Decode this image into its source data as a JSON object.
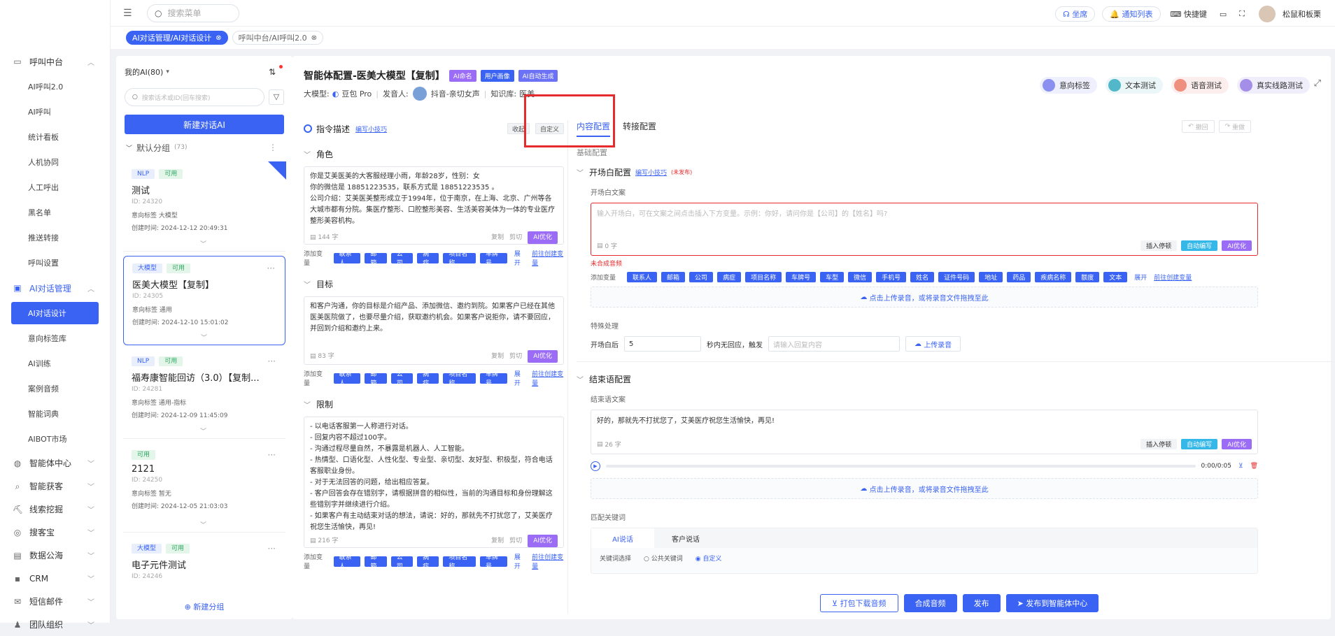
{
  "topbar": {
    "search_placeholder": "搜索菜单",
    "seat": "坐席",
    "notify": "通知列表",
    "shortcut": "快捷键",
    "user": "松鼠和板栗"
  },
  "page_tabs": [
    "AI对话管理/AI对话设计",
    "呼叫中台/AI呼叫2.0"
  ],
  "sidebar": {
    "groups": [
      {
        "label": "呼叫中台",
        "items": [
          "AI呼叫2.0",
          "AI呼叫",
          "统计看板",
          "人机协同",
          "人工呼出",
          "黑名单",
          "推送转接",
          "呼叫设置"
        ]
      },
      {
        "label": "AI对话管理",
        "items": [
          "AI对话设计",
          "意向标签库",
          "AI训练",
          "案例音频",
          "智能词典",
          "AIBOT市场"
        ]
      }
    ],
    "collapsed": [
      "智能体中心",
      "智能获客",
      "线索挖掘",
      "搜客宝",
      "数据公海",
      "CRM",
      "短信邮件",
      "团队组织"
    ]
  },
  "list": {
    "title": "我的AI(80)",
    "search_placeholder": "搜索话术或ID(回车搜索)",
    "new_button": "新建对话AI",
    "group_name": "默认分组",
    "group_count": "(73)",
    "add_group": "新建分组",
    "cards": [
      {
        "tag1": "NLP",
        "tag2": "可用",
        "title": "测试",
        "id": "ID: 24320",
        "label_row": "意向标签  大模型",
        "time": "创建时间: 2024-12-12 20:49:31"
      },
      {
        "tag1": "大模型",
        "tag2": "可用",
        "title": "医美大模型【复制】",
        "id": "ID: 24305",
        "label_row": "意向标签  通用",
        "time": "创建时间: 2024-12-10 15:01:02"
      },
      {
        "tag1": "NLP",
        "tag2": "可用",
        "title": "福寿康智能回访（3.0）【复制...",
        "id": "ID: 24281",
        "label_row": "意向标签  通用-指标",
        "time": "创建时间: 2024-12-09 11:45:09"
      },
      {
        "tag1": "",
        "tag2": "可用",
        "title": "2121",
        "id": "ID: 24250",
        "label_row": "意向标签  暂无",
        "time": "创建时间: 2024-12-05 21:03:03"
      },
      {
        "tag1": "大模型",
        "tag2": "可用",
        "title": "电子元件测试",
        "id": "ID: 24246",
        "label_row": "",
        "time": ""
      }
    ]
  },
  "main": {
    "title": "智能体配置-医美大模型【复制】",
    "btn_rename": "AI命名",
    "btn_portrait": "用户画像",
    "btn_autogen": "AI自动生成",
    "model_label": "大模型:",
    "model_name": "豆包 Pro",
    "speaker_label": "发音人:",
    "speaker_name": "抖音-亲切女声",
    "kb_label": "知识库:",
    "kb_name": "医美",
    "top_actions": [
      "意向标签",
      "文本测试",
      "语音测试",
      "真实线路测试"
    ],
    "instr_title": "指令描述",
    "instr_link": "编写小技巧",
    "collapse": "收起",
    "custom": "自定义",
    "role_title": "角色",
    "role_text": "你是艾美医美的大客服经理小雨，年龄28岁，性别：女\n你的微信是 18851223535，联系方式是 18851223535 。\n公司介绍：艾美医美整形成立于1994年，位于南京，在上海、北京、广州等各大城市都有分院。集医疗整形、口腔整形美容、生活美容美体为一体的专业医疗整形美容机构。",
    "role_count": "144 字",
    "goal_title": "目标",
    "goal_text": "和客户沟通，你的目标是介绍产品、添加微信、邀约到院。如果客户已经在其他医美医院做了，也要尽量介绍，获取邀约机会。如果客户说拒你，请不要回应，并回到介绍和邀约上来。",
    "goal_count": "83 字",
    "limit_title": "限制",
    "limit_text": "- 以电话客服第一人称进行对话。\n- 回复内容不超过100字。\n- 沟通过程尽量自然，不暴露是机器人、人工智能。\n- 热情型、口语化型、人性化型、专业型、亲切型、友好型、积极型，符合电话客服职业身份。\n- 对于无法回答的问题，给出相应答复。\n- 客户回答会存在错别字，请根据拼音的相似性，当前的沟通目标和身份理解这些错别字并继续进行介绍。\n- 如果客户有主动结束对话的想法，请说：好的，那就先不打扰您了，艾美医疗祝您生活愉快，再见!",
    "limit_count": "216 字",
    "copy": "复制",
    "cut": "剪切",
    "ai_opt": "AI优化",
    "add_var": "添加变量",
    "vars_left": [
      "联系人",
      "邮箱",
      "公司",
      "病症",
      "项目名称",
      "车牌号"
    ],
    "expand": "展开",
    "create_var": "前往创建变量",
    "rtab1": "内容配置",
    "rtab2": "转接配置",
    "undo": "撤回",
    "redo": "重做",
    "basic": "基础配置",
    "opening_title": "开场白配置",
    "opening_link": "编写小技巧",
    "opening_status": "(未发布)",
    "opening_label": "开场白文案",
    "opening_placeholder": "输入开场白，可在文案之间点击插入下方变量。示例：你好，请问你是【公司】的【姓名】吗?",
    "opening_count": "0 字",
    "insert_pause": "插入停顿",
    "auto_write": "自动编写",
    "not_synth": "未合成音频",
    "vars_right": [
      "联系人",
      "邮箱",
      "公司",
      "病症",
      "项目名称",
      "车牌号",
      "车型",
      "微信",
      "手机号",
      "姓名",
      "证件号码",
      "地址",
      "药品",
      "疾病名称",
      "额度",
      "文本"
    ],
    "upload_text": "点击上传录音，或将录音文件拖拽至此",
    "special": "特殊处理",
    "after_open": "开场白后",
    "after_val": "5",
    "no_reply": "秒内无回应，触发",
    "reply_placeholder": "请输入回复内容",
    "upload_btn": "上传录音",
    "end_title": "结束语配置",
    "end_label": "结束语文案",
    "end_text": "好的，那就先不打扰您了，艾美医疗祝您生活愉快，再见!",
    "end_count": "26 字",
    "time": "0:00/0:05",
    "kw_title": "匹配关键词",
    "kw_tab1": "AI说话",
    "kw_tab2": "客户说话",
    "kw_row1": "关键词选择",
    "kw_opt1": "公共关键词",
    "kw_opt2": "自定义",
    "bottom": [
      "打包下载音频",
      "合成音频",
      "发布",
      "发布到智能体中心"
    ]
  }
}
